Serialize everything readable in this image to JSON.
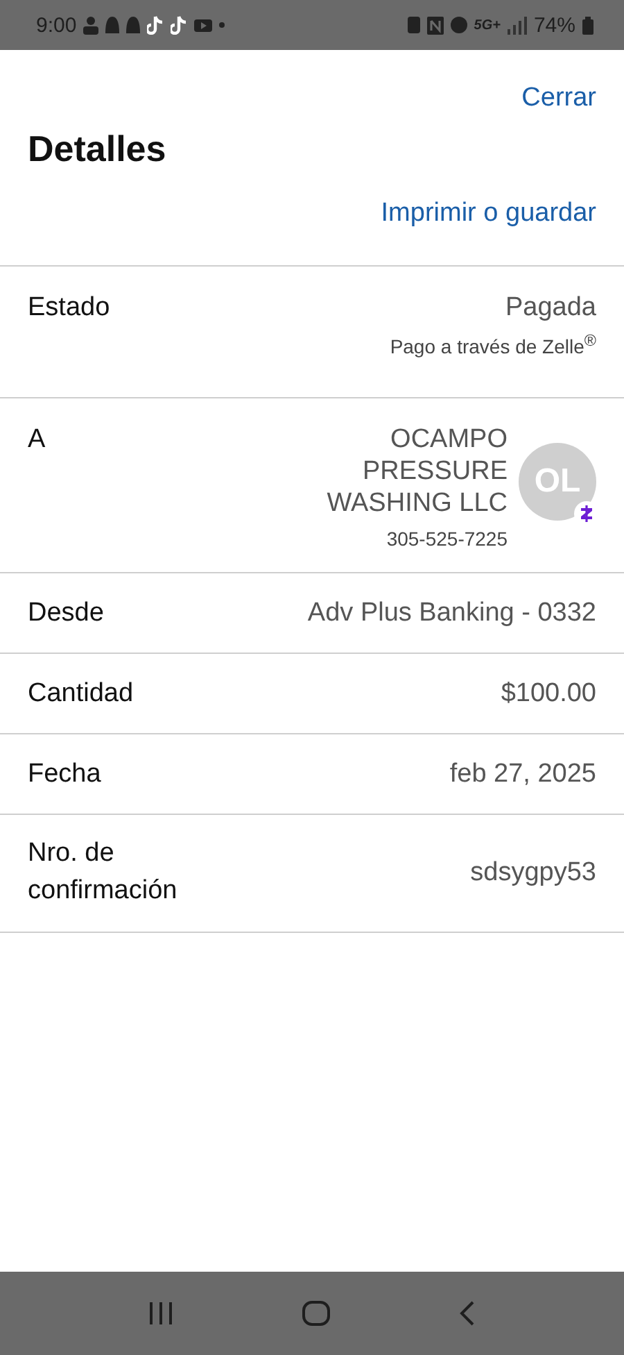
{
  "status_bar": {
    "time": "9:00",
    "network": "5G+",
    "battery": "74%"
  },
  "header": {
    "close": "Cerrar",
    "title": "Detalles",
    "print": "Imprimir o guardar"
  },
  "rows": [
    {
      "kind": "status",
      "label": "Estado",
      "value": "Pagada",
      "note": "Pago a través de Zelle$^{®}$"
    },
    {
      "kind": "recipient",
      "label": "A",
      "name_lines": [
        "OCAMPO",
        "PRESSURE",
        "WASHING LLC"
      ],
      "phone": "305-525-7225",
      "initials": "OL"
    },
    {
      "kind": "plain",
      "label": "Desde",
      "value": "Adv Plus Banking - 0332"
    },
    {
      "kind": "plain",
      "label": "Cantidad",
      "value": "$100.00"
    },
    {
      "kind": "plain",
      "label": "Fecha",
      "value": "feb 27, 2025"
    },
    {
      "kind": "plain",
      "label": "Nro. de confirmación",
      "value": "sdsygpy53"
    }
  ]
}
